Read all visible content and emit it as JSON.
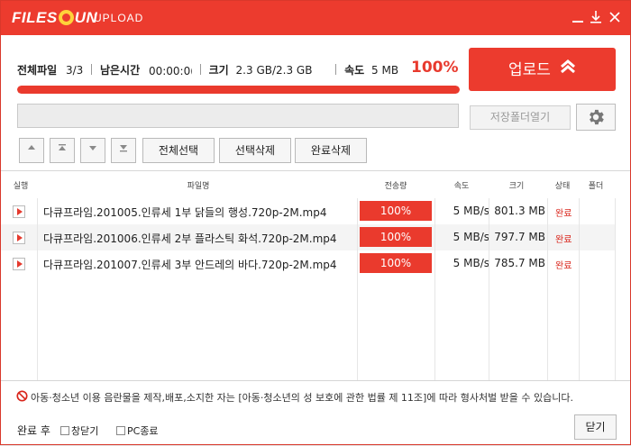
{
  "title": {
    "logo": "FILESUN",
    "logo_pre": "FILE",
    "logo_post": "UN",
    "tag": "UPLOAD"
  },
  "stats": {
    "total_label": "전체파일",
    "total_value": "3/3",
    "remain_label": "남은시간",
    "remain_value": "00:00:0(",
    "size_label": "크기",
    "size_value": "2.3 GB/2.3 GB",
    "speed_label": "속도",
    "speed_value": "5 MB",
    "percent": "100%",
    "progress_fraction": 1.0
  },
  "buttons": {
    "upload": "업로드",
    "open_folder": "저장폴더열기",
    "select_all": "전체선택",
    "delete_selected": "선택삭제",
    "delete_done": "완료삭제",
    "close": "닫기"
  },
  "columns": [
    "실행",
    "파일명",
    "전송량",
    "속도",
    "크기",
    "상태",
    "폴더"
  ],
  "files": [
    {
      "name": "다큐프라임.201005.인류세 1부 닭들의 행성.720p-2M.mp4",
      "progress": "100%",
      "speed": "5 MB/s",
      "size": "801.3 MB",
      "state": "완료"
    },
    {
      "name": "다큐프라임.201006.인류세 2부 플라스틱 화석.720p-2M.mp4",
      "progress": "100%",
      "speed": "5 MB/s",
      "size": "797.7 MB",
      "state": "완료"
    },
    {
      "name": "다큐프라임.201007.인류세 3부 안드레의 바다.720p-2M.mp4",
      "progress": "100%",
      "speed": "5 MB/s",
      "size": "785.7 MB",
      "state": "완료"
    }
  ],
  "warning": "아동·청소년 이용 음란물을 제작,배포,소지한 자는 [아동·청소년의 성 보호에 관한 법률 제 11조]에 따라 형사처벌 받을 수 있습니다.",
  "footer": {
    "after_label": "완료 후",
    "close_window": "창닫기",
    "pc_shutdown": "PC종료"
  },
  "colors": {
    "accent": "#ec3b2e",
    "status_done": "#d9251b"
  }
}
